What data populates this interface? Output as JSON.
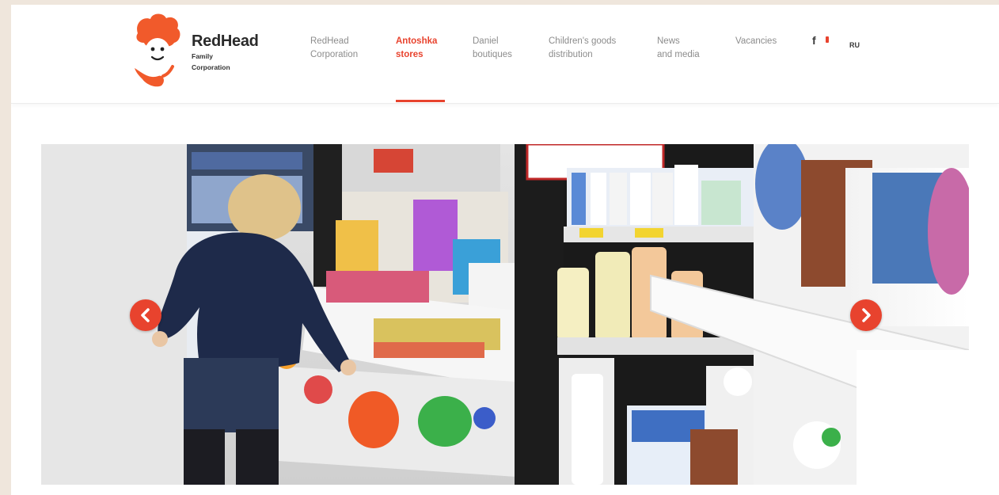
{
  "brand": {
    "title": "RedHead",
    "subtitle_line1": "Family",
    "subtitle_line2": "Corporation",
    "accent_color": "#e8432e"
  },
  "nav": {
    "items": [
      {
        "line1": "RedHead",
        "line2": "Corporation",
        "active": false
      },
      {
        "line1": "Antoshka",
        "line2": "stores",
        "active": true
      },
      {
        "line1": "Daniel",
        "line2": "boutiques",
        "active": false
      },
      {
        "line1": "Children's goods",
        "line2": "distribution",
        "active": false
      },
      {
        "line1": "News",
        "line2": "and media",
        "active": false
      },
      {
        "line1": "Vacancies",
        "line2": "",
        "active": false
      }
    ]
  },
  "social": {
    "facebook_label": "f",
    "facebook_icon": "facebook-icon"
  },
  "language": {
    "current": "RU"
  },
  "slider": {
    "prev_icon": "chevron-left-icon",
    "next_icon": "chevron-right-icon",
    "photo_description_icon": "store-photo"
  }
}
